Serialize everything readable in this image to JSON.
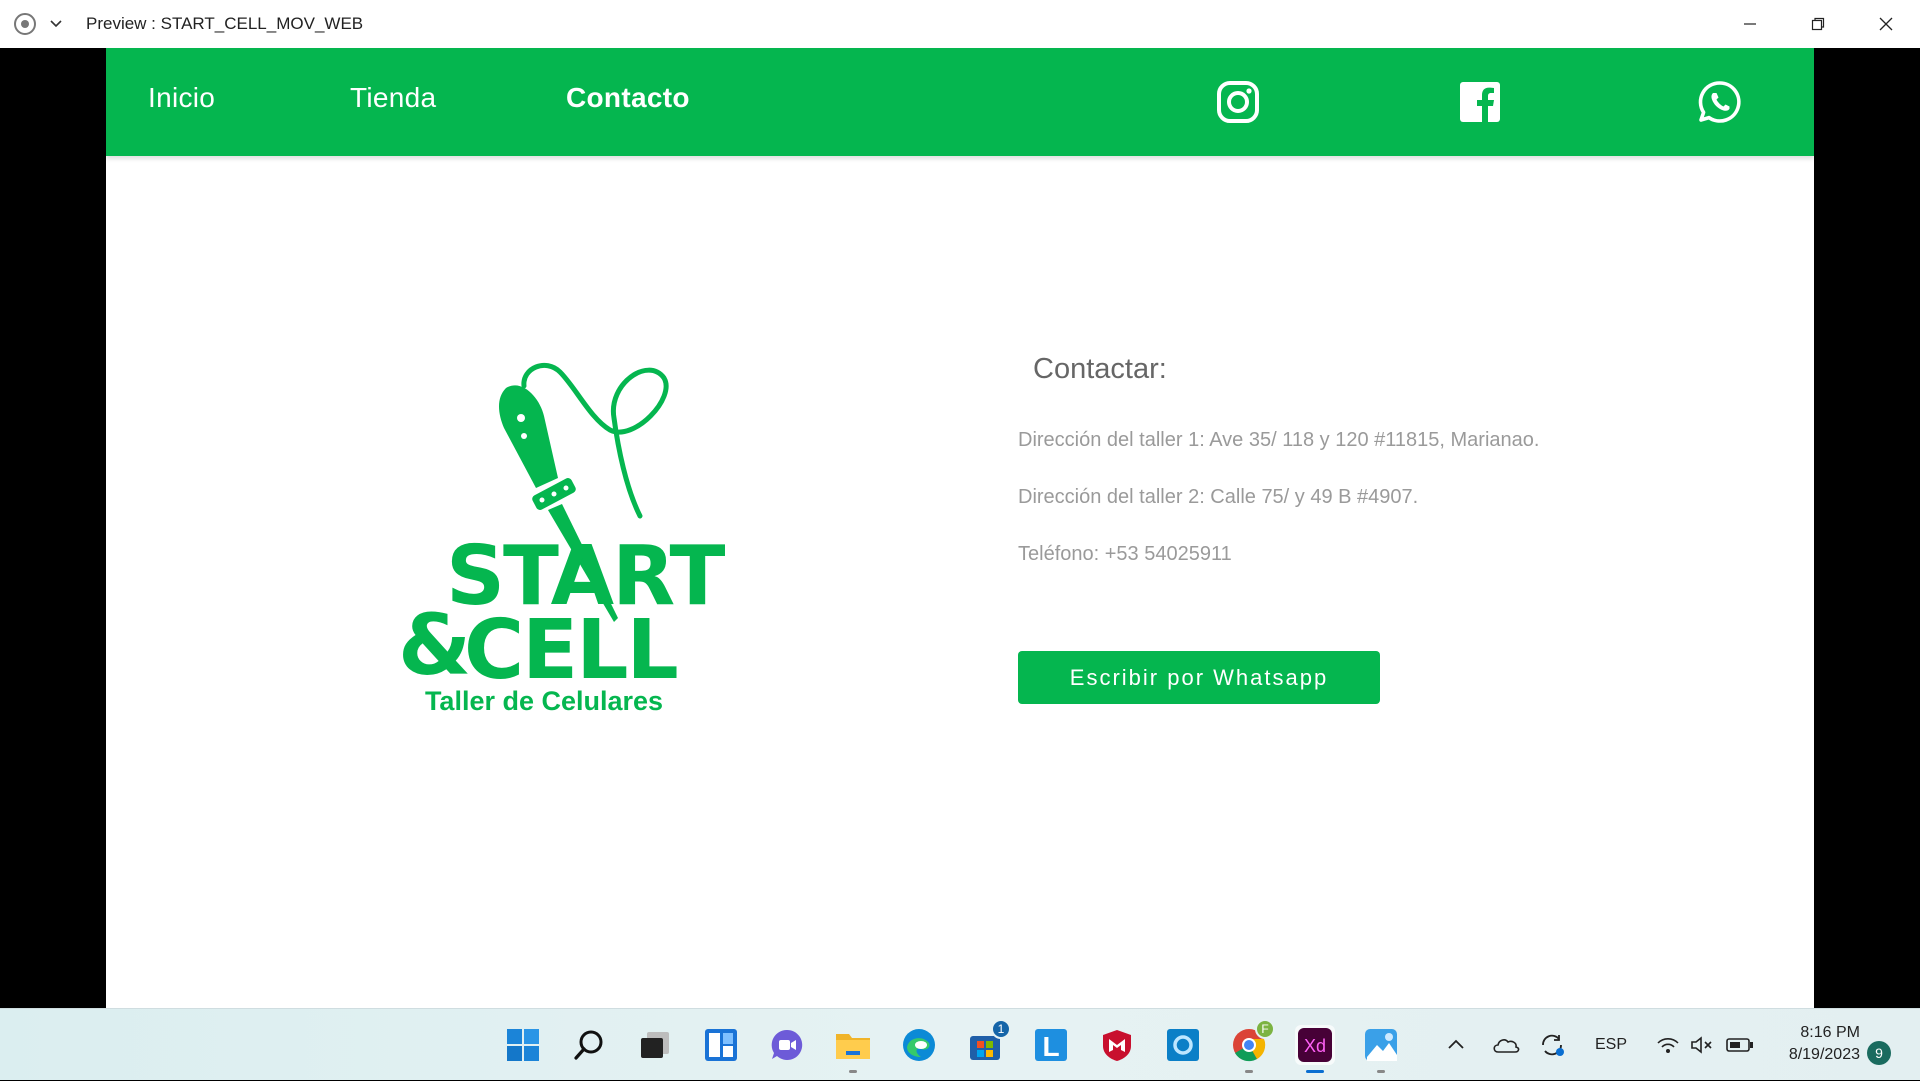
{
  "window": {
    "title": "Preview : START_CELL_MOV_WEB",
    "app_icon": "preview-record-icon",
    "controls": [
      "minimize-icon",
      "restore-icon",
      "close-icon"
    ]
  },
  "navbar": {
    "links": [
      {
        "label": "Inicio",
        "active": false
      },
      {
        "label": "Tienda",
        "active": false
      },
      {
        "label": "Contacto",
        "active": true
      }
    ],
    "social_icons": [
      "instagram-icon",
      "facebook-icon",
      "whatsapp-icon"
    ],
    "color": "#05b64f"
  },
  "logo": {
    "text_top": "START",
    "text_amp": "&",
    "text_bottom": "CELL",
    "tagline": "Taller de Celulares"
  },
  "contact": {
    "heading": "Contactar:",
    "address1": "Dirección del taller 1: Ave 35/ 118 y 120 #11815, Marianao.",
    "address2": "Dirección del taller 2: Calle 75/ y 49 B #4907.",
    "phone": "Teléfono: +53 54025911",
    "button": "Escribir por Whatsapp"
  },
  "taskbar": {
    "apps": [
      "start-icon",
      "search-icon",
      "task-view-icon",
      "widgets-icon",
      "teams-chat-icon",
      "file-explorer-icon",
      "edge-icon",
      "microsoft-store-icon",
      "l-app-icon",
      "mcafee-icon",
      "cortana-icon",
      "chrome-icon",
      "adobe-xd-icon",
      "photos-icon"
    ],
    "store_badge": "1",
    "chrome_badge": "F",
    "xd_label": "Xd",
    "l_label": "L",
    "language": "ESP",
    "time": "8:16 PM",
    "date": "8/19/2023",
    "notifications": "9"
  }
}
